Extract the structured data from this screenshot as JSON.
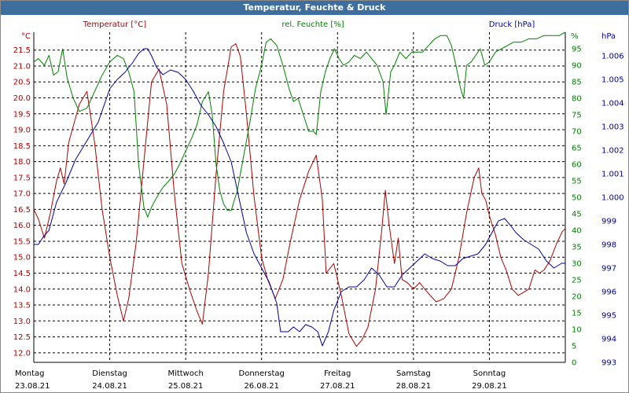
{
  "chart_data": {
    "type": "line",
    "title": "Temperatur, Feuchte & Druck",
    "legend": {
      "temp": "Temperatur [°C]",
      "hum": "rel. Feuchte [%]",
      "press": "Druck [hPa]"
    },
    "units": {
      "left": "°C",
      "right": "%",
      "far_right": "hPa"
    },
    "colors": {
      "temp": "#b00000",
      "hum": "#008000",
      "press": "#0000a0",
      "title_bg": "#3d6e9e"
    },
    "grid": true,
    "y_temp": {
      "min": 11.7,
      "max": 22.06,
      "ticks": [
        "12.0",
        "12.5",
        "13.0",
        "13.5",
        "14.0",
        "14.5",
        "15.0",
        "15.5",
        "16.0",
        "16.5",
        "17.0",
        "17.5",
        "18.0",
        "18.5",
        "19.0",
        "19.5",
        "20.0",
        "20.5",
        "21.0",
        "21.5"
      ]
    },
    "y_hum": {
      "min": 0,
      "max": 100,
      "ticks": [
        "0",
        "5",
        "10",
        "15",
        "20",
        "25",
        "30",
        "35",
        "40",
        "45",
        "50",
        "55",
        "60",
        "65",
        "70",
        "75",
        "80",
        "85",
        "90",
        "95"
      ]
    },
    "y_press": {
      "min": 993,
      "max": 1007,
      "ticks": [
        "993",
        "994",
        "995",
        "996",
        "997",
        "998",
        "999",
        "1.000",
        "1.001",
        "1.002",
        "1.003",
        "1.004",
        "1.005",
        "1.006"
      ]
    },
    "days": [
      {
        "name": "Montag",
        "date": "23.08.21"
      },
      {
        "name": "Dienstag",
        "date": "24.08.21"
      },
      {
        "name": "Mittwoch",
        "date": "25.08.21"
      },
      {
        "name": "Donnerstag",
        "date": "26.08.21"
      },
      {
        "name": "Freitag",
        "date": "27.08.21"
      },
      {
        "name": "Samstag",
        "date": "28.08.21"
      },
      {
        "name": "Sonntag",
        "date": "29.08.21"
      }
    ],
    "x_range_days": [
      0,
      7
    ],
    "series": [
      {
        "name": "Temperatur [°C]",
        "key": "temp",
        "points": [
          [
            0,
            16.5
          ],
          [
            0.06,
            16.2
          ],
          [
            0.14,
            15.6
          ],
          [
            0.22,
            16.4
          ],
          [
            0.3,
            17.4
          ],
          [
            0.35,
            17.8
          ],
          [
            0.4,
            17.3
          ],
          [
            0.46,
            18.6
          ],
          [
            0.6,
            19.8
          ],
          [
            0.7,
            20.2
          ],
          [
            0.8,
            18.6
          ],
          [
            0.9,
            16.5
          ],
          [
            1.0,
            15.0
          ],
          [
            1.1,
            13.8
          ],
          [
            1.18,
            13.0
          ],
          [
            1.25,
            13.7
          ],
          [
            1.35,
            15.5
          ],
          [
            1.45,
            18.0
          ],
          [
            1.55,
            20.5
          ],
          [
            1.65,
            20.9
          ],
          [
            1.75,
            19.8
          ],
          [
            1.85,
            17.0
          ],
          [
            1.95,
            14.8
          ],
          [
            2.05,
            14.0
          ],
          [
            2.15,
            13.3
          ],
          [
            2.22,
            12.9
          ],
          [
            2.3,
            14.5
          ],
          [
            2.4,
            17.6
          ],
          [
            2.5,
            20.2
          ],
          [
            2.6,
            21.6
          ],
          [
            2.66,
            21.7
          ],
          [
            2.72,
            21.3
          ],
          [
            2.8,
            19.5
          ],
          [
            2.9,
            16.9
          ],
          [
            3.0,
            15.0
          ],
          [
            3.08,
            14.3
          ],
          [
            3.18,
            13.7
          ],
          [
            3.28,
            14.3
          ],
          [
            3.38,
            15.5
          ],
          [
            3.5,
            16.8
          ],
          [
            3.62,
            17.7
          ],
          [
            3.72,
            18.2
          ],
          [
            3.8,
            16.8
          ],
          [
            3.85,
            14.5
          ],
          [
            3.95,
            14.8
          ],
          [
            4.05,
            13.8
          ],
          [
            4.15,
            12.6
          ],
          [
            4.25,
            12.2
          ],
          [
            4.32,
            12.4
          ],
          [
            4.4,
            12.8
          ],
          [
            4.5,
            14.0
          ],
          [
            4.58,
            15.8
          ],
          [
            4.63,
            17.1
          ],
          [
            4.68,
            16.0
          ],
          [
            4.75,
            14.8
          ],
          [
            4.8,
            15.6
          ],
          [
            4.85,
            14.3
          ],
          [
            4.92,
            14.2
          ],
          [
            5.0,
            14.0
          ],
          [
            5.08,
            14.2
          ],
          [
            5.15,
            14.0
          ],
          [
            5.22,
            13.8
          ],
          [
            5.3,
            13.6
          ],
          [
            5.4,
            13.7
          ],
          [
            5.5,
            14.0
          ],
          [
            5.6,
            15.0
          ],
          [
            5.7,
            16.4
          ],
          [
            5.8,
            17.5
          ],
          [
            5.86,
            17.8
          ],
          [
            5.9,
            17.0
          ],
          [
            5.95,
            16.8
          ],
          [
            6.0,
            16.3
          ],
          [
            6.08,
            15.7
          ],
          [
            6.15,
            15.0
          ],
          [
            6.22,
            14.6
          ],
          [
            6.3,
            14.0
          ],
          [
            6.38,
            13.8
          ],
          [
            6.45,
            13.9
          ],
          [
            6.52,
            14.0
          ],
          [
            6.6,
            14.6
          ],
          [
            6.66,
            14.5
          ],
          [
            6.72,
            14.6
          ],
          [
            6.8,
            14.9
          ],
          [
            6.88,
            15.4
          ],
          [
            6.96,
            15.8
          ],
          [
            7.0,
            15.9
          ]
        ]
      },
      {
        "name": "rel. Feuchte [%]",
        "key": "hum",
        "points": [
          [
            0,
            91
          ],
          [
            0.06,
            92
          ],
          [
            0.14,
            90
          ],
          [
            0.2,
            93
          ],
          [
            0.26,
            87
          ],
          [
            0.32,
            88
          ],
          [
            0.38,
            95
          ],
          [
            0.44,
            86
          ],
          [
            0.52,
            80
          ],
          [
            0.6,
            76
          ],
          [
            0.7,
            77
          ],
          [
            0.8,
            82
          ],
          [
            0.9,
            87
          ],
          [
            1.0,
            91
          ],
          [
            1.1,
            93
          ],
          [
            1.18,
            92
          ],
          [
            1.25,
            88
          ],
          [
            1.32,
            82
          ],
          [
            1.38,
            60
          ],
          [
            1.45,
            47
          ],
          [
            1.5,
            44
          ],
          [
            1.55,
            47
          ],
          [
            1.62,
            50
          ],
          [
            1.7,
            53
          ],
          [
            1.78,
            55
          ],
          [
            1.85,
            57
          ],
          [
            1.92,
            60
          ],
          [
            2.0,
            64
          ],
          [
            2.08,
            68
          ],
          [
            2.15,
            72
          ],
          [
            2.22,
            79
          ],
          [
            2.3,
            82
          ],
          [
            2.35,
            75
          ],
          [
            2.4,
            60
          ],
          [
            2.45,
            52
          ],
          [
            2.5,
            48
          ],
          [
            2.55,
            46
          ],
          [
            2.6,
            46
          ],
          [
            2.68,
            52
          ],
          [
            2.76,
            62
          ],
          [
            2.84,
            72
          ],
          [
            2.92,
            83
          ],
          [
            3.0,
            90
          ],
          [
            3.06,
            97
          ],
          [
            3.12,
            98
          ],
          [
            3.2,
            96
          ],
          [
            3.28,
            90
          ],
          [
            3.36,
            83
          ],
          [
            3.42,
            79
          ],
          [
            3.48,
            80
          ],
          [
            3.55,
            75
          ],
          [
            3.62,
            70
          ],
          [
            3.68,
            70
          ],
          [
            3.72,
            69
          ],
          [
            3.78,
            82
          ],
          [
            3.84,
            88
          ],
          [
            3.9,
            92
          ],
          [
            3.96,
            95
          ],
          [
            4.02,
            92
          ],
          [
            4.08,
            90
          ],
          [
            4.15,
            91
          ],
          [
            4.22,
            93
          ],
          [
            4.3,
            92
          ],
          [
            4.38,
            94
          ],
          [
            4.45,
            92
          ],
          [
            4.52,
            90
          ],
          [
            4.6,
            85
          ],
          [
            4.64,
            75
          ],
          [
            4.7,
            88
          ],
          [
            4.75,
            90
          ],
          [
            4.82,
            94
          ],
          [
            4.9,
            92
          ],
          [
            4.98,
            94
          ],
          [
            5.05,
            94
          ],
          [
            5.12,
            94
          ],
          [
            5.2,
            96
          ],
          [
            5.28,
            98
          ],
          [
            5.36,
            99
          ],
          [
            5.44,
            99
          ],
          [
            5.5,
            96
          ],
          [
            5.56,
            90
          ],
          [
            5.62,
            83
          ],
          [
            5.66,
            80
          ],
          [
            5.7,
            90
          ],
          [
            5.76,
            91
          ],
          [
            5.82,
            93
          ],
          [
            5.88,
            95
          ],
          [
            5.94,
            90
          ],
          [
            6.0,
            91
          ],
          [
            6.08,
            94
          ],
          [
            6.16,
            95
          ],
          [
            6.24,
            96
          ],
          [
            6.32,
            97
          ],
          [
            6.42,
            97
          ],
          [
            6.52,
            98
          ],
          [
            6.62,
            98
          ],
          [
            6.72,
            99
          ],
          [
            6.82,
            99
          ],
          [
            6.92,
            99
          ],
          [
            7.0,
            100
          ]
        ]
      },
      {
        "name": "Druck [hPa]",
        "key": "press",
        "points": [
          [
            0,
            998
          ],
          [
            0.06,
            998
          ],
          [
            0.12,
            998.3
          ],
          [
            0.2,
            998.6
          ],
          [
            0.3,
            999.8
          ],
          [
            0.42,
            1000.6
          ],
          [
            0.55,
            1001.6
          ],
          [
            0.7,
            1002.4
          ],
          [
            0.85,
            1003.2
          ],
          [
            1.0,
            1004.6
          ],
          [
            1.1,
            1005.0
          ],
          [
            1.2,
            1005.3
          ],
          [
            1.3,
            1005.7
          ],
          [
            1.38,
            1006.1
          ],
          [
            1.45,
            1006.3
          ],
          [
            1.5,
            1006.3
          ],
          [
            1.55,
            1006.0
          ],
          [
            1.62,
            1005.5
          ],
          [
            1.7,
            1005.2
          ],
          [
            1.8,
            1005.4
          ],
          [
            1.9,
            1005.3
          ],
          [
            2.0,
            1005.0
          ],
          [
            2.1,
            1004.5
          ],
          [
            2.2,
            1003.9
          ],
          [
            2.3,
            1003.5
          ],
          [
            2.4,
            1003.0
          ],
          [
            2.5,
            1002.3
          ],
          [
            2.6,
            1001.5
          ],
          [
            2.7,
            1000.0
          ],
          [
            2.8,
            998.5
          ],
          [
            2.9,
            997.6
          ],
          [
            3.0,
            997.0
          ],
          [
            3.1,
            996.4
          ],
          [
            3.2,
            995.5
          ],
          [
            3.25,
            994.3
          ],
          [
            3.35,
            994.3
          ],
          [
            3.42,
            994.5
          ],
          [
            3.5,
            994.3
          ],
          [
            3.58,
            994.6
          ],
          [
            3.66,
            994.5
          ],
          [
            3.74,
            994.3
          ],
          [
            3.8,
            993.7
          ],
          [
            3.88,
            994.3
          ],
          [
            3.95,
            995.2
          ],
          [
            4.05,
            996.0
          ],
          [
            4.15,
            996.2
          ],
          [
            4.25,
            996.2
          ],
          [
            4.35,
            996.5
          ],
          [
            4.45,
            997.0
          ],
          [
            4.55,
            996.7
          ],
          [
            4.65,
            996.2
          ],
          [
            4.75,
            996.2
          ],
          [
            4.85,
            996.7
          ],
          [
            4.95,
            997.0
          ],
          [
            5.05,
            997.3
          ],
          [
            5.15,
            997.6
          ],
          [
            5.25,
            997.4
          ],
          [
            5.35,
            997.3
          ],
          [
            5.45,
            997.1
          ],
          [
            5.55,
            997.1
          ],
          [
            5.65,
            997.4
          ],
          [
            5.75,
            997.5
          ],
          [
            5.85,
            997.6
          ],
          [
            5.95,
            998.0
          ],
          [
            6.05,
            998.6
          ],
          [
            6.12,
            999.0
          ],
          [
            6.2,
            999.1
          ],
          [
            6.28,
            998.8
          ],
          [
            6.35,
            998.5
          ],
          [
            6.45,
            998.2
          ],
          [
            6.55,
            998.0
          ],
          [
            6.65,
            997.8
          ],
          [
            6.75,
            997.3
          ],
          [
            6.85,
            997.0
          ],
          [
            6.95,
            997.2
          ],
          [
            7.0,
            997.2
          ]
        ]
      }
    ]
  }
}
